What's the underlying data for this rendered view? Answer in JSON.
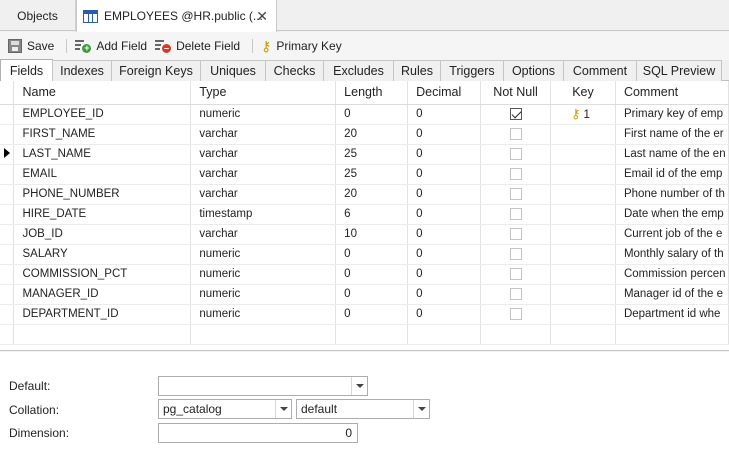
{
  "doc_tabs": {
    "objects_label": "Objects",
    "active_label": "EMPLOYEES @HR.public (..."
  },
  "toolbar": {
    "save_label": "Save",
    "add_field_label": "Add Field",
    "delete_field_label": "Delete Field",
    "primary_key_label": "Primary Key"
  },
  "subtabs": [
    {
      "label": "Fields"
    },
    {
      "label": "Indexes"
    },
    {
      "label": "Foreign Keys"
    },
    {
      "label": "Uniques"
    },
    {
      "label": "Checks"
    },
    {
      "label": "Excludes"
    },
    {
      "label": "Rules"
    },
    {
      "label": "Triggers"
    },
    {
      "label": "Options"
    },
    {
      "label": "Comment"
    },
    {
      "label": "SQL Preview"
    }
  ],
  "grid": {
    "columns": [
      "Name",
      "Type",
      "Length",
      "Decimal",
      "Not Null",
      "Key",
      "Comment"
    ],
    "rows": [
      {
        "name": "EMPLOYEE_ID",
        "type": "numeric",
        "length": "0",
        "decimal": "0",
        "not_null": true,
        "key": "1",
        "comment": "Primary key of emp"
      },
      {
        "name": "FIRST_NAME",
        "type": "varchar",
        "length": "20",
        "decimal": "0",
        "not_null": false,
        "key": "",
        "comment": "First name of the er"
      },
      {
        "name": "LAST_NAME",
        "type": "varchar",
        "length": "25",
        "decimal": "0",
        "not_null": false,
        "key": "",
        "comment": "Last name of the en"
      },
      {
        "name": "EMAIL",
        "type": "varchar",
        "length": "25",
        "decimal": "0",
        "not_null": false,
        "key": "",
        "comment": "Email id of the emp"
      },
      {
        "name": "PHONE_NUMBER",
        "type": "varchar",
        "length": "20",
        "decimal": "0",
        "not_null": false,
        "key": "",
        "comment": "Phone number of th"
      },
      {
        "name": "HIRE_DATE",
        "type": "timestamp",
        "length": "6",
        "decimal": "0",
        "not_null": false,
        "key": "",
        "comment": "Date when the emp"
      },
      {
        "name": "JOB_ID",
        "type": "varchar",
        "length": "10",
        "decimal": "0",
        "not_null": false,
        "key": "",
        "comment": "Current job of the e"
      },
      {
        "name": "SALARY",
        "type": "numeric",
        "length": "0",
        "decimal": "0",
        "not_null": false,
        "key": "",
        "comment": "Monthly salary of th"
      },
      {
        "name": "COMMISSION_PCT",
        "type": "numeric",
        "length": "0",
        "decimal": "0",
        "not_null": false,
        "key": "",
        "comment": "Commission percen"
      },
      {
        "name": "MANAGER_ID",
        "type": "numeric",
        "length": "0",
        "decimal": "0",
        "not_null": false,
        "key": "",
        "comment": "Manager id of the e"
      },
      {
        "name": "DEPARTMENT_ID",
        "type": "numeric",
        "length": "0",
        "decimal": "0",
        "not_null": false,
        "key": "",
        "comment": "Department id whe"
      }
    ]
  },
  "properties": {
    "default_label": "Default:",
    "default_value": "",
    "collation_label": "Collation:",
    "collation_schema": "pg_catalog",
    "collation_value": "default",
    "dimension_label": "Dimension:",
    "dimension_value": "0"
  }
}
